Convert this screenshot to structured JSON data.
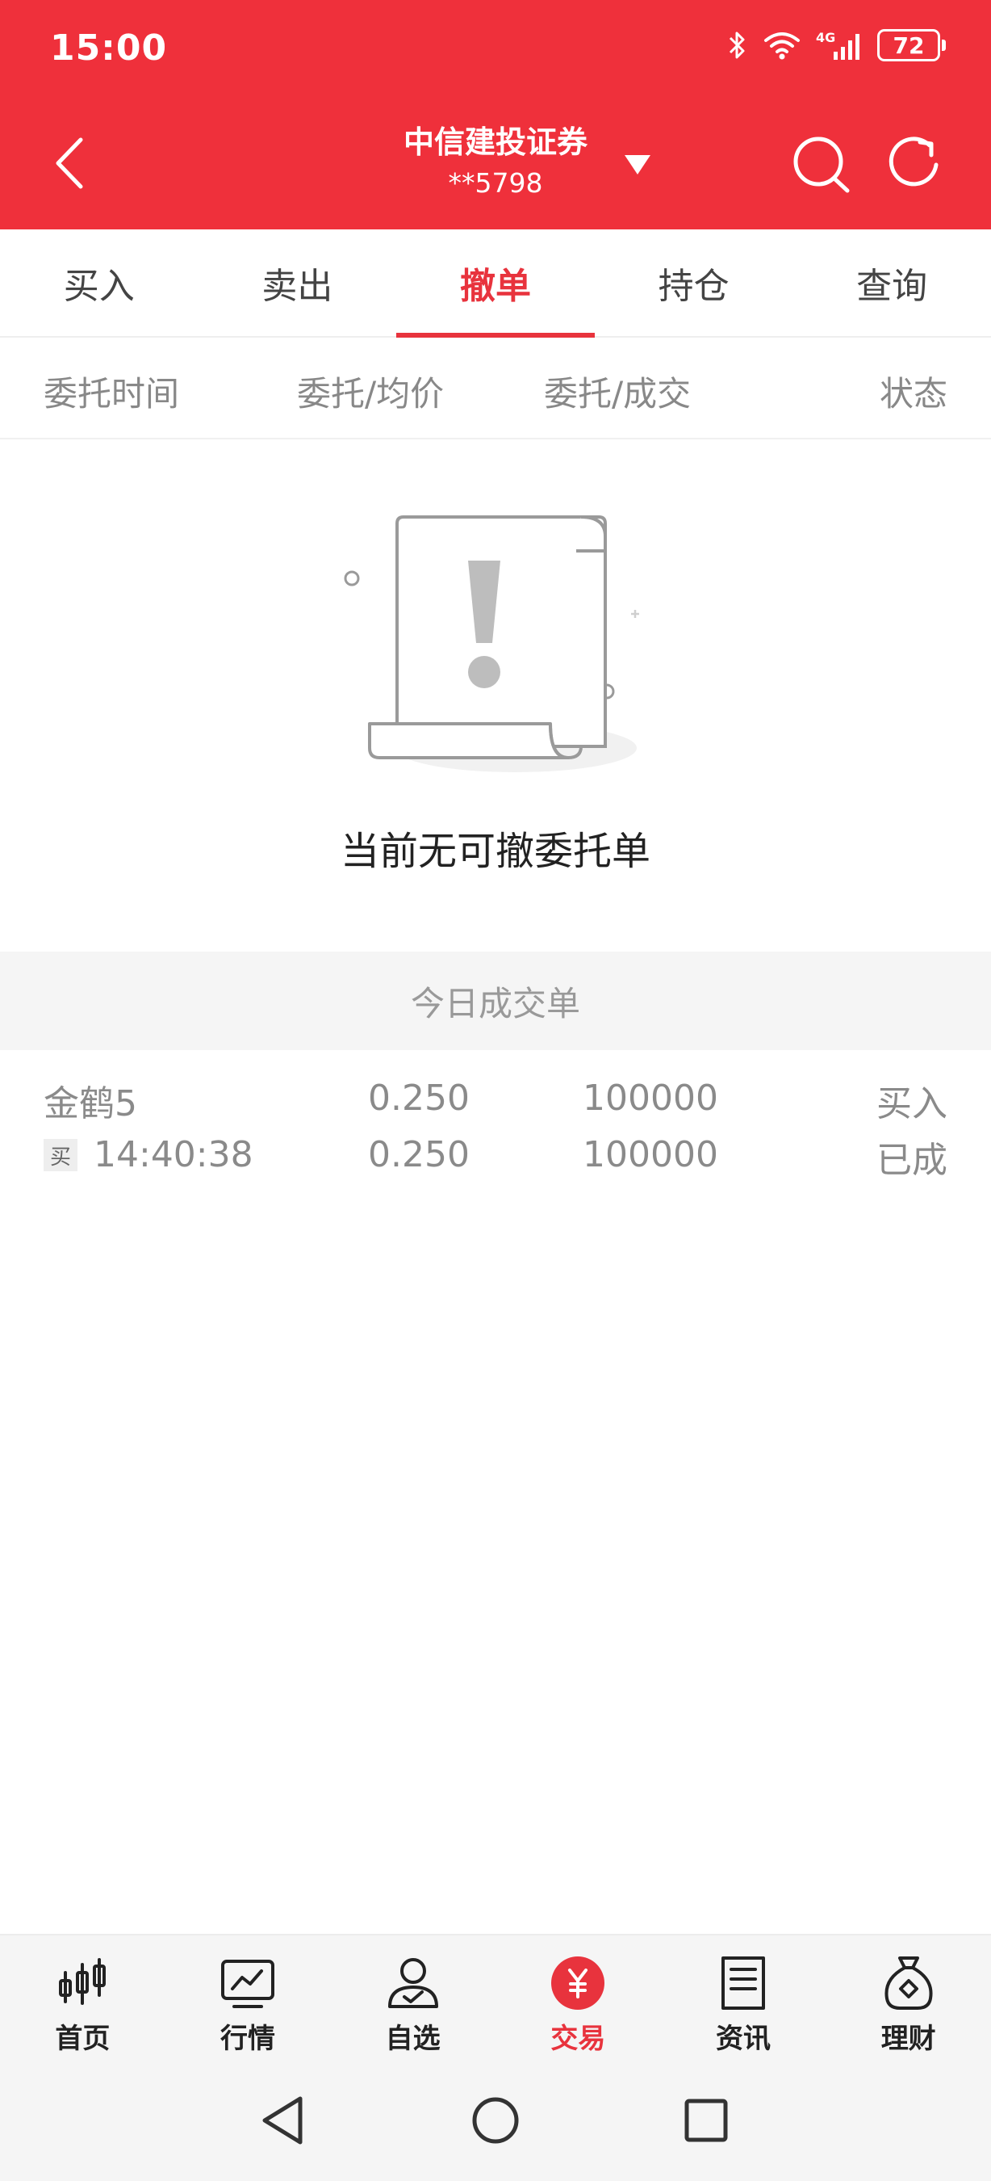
{
  "status_bar": {
    "time": "15:00",
    "network": "4G",
    "battery": "72"
  },
  "header": {
    "broker_name": "中信建投证券",
    "account": "**5798"
  },
  "main_tabs": [
    {
      "label": "买入",
      "active": false
    },
    {
      "label": "卖出",
      "active": false
    },
    {
      "label": "撤单",
      "active": true
    },
    {
      "label": "持仓",
      "active": false
    },
    {
      "label": "查询",
      "active": false
    }
  ],
  "column_headers": [
    "委托时间",
    "委托/均价",
    "委托/成交",
    "状态"
  ],
  "empty_state": {
    "message": "当前无可撤委托单"
  },
  "today_deals": {
    "section_title": "今日成交单",
    "rows": [
      {
        "name": "金鹤5",
        "side_tag": "买",
        "time": "14:40:38",
        "order_price": "0.250",
        "avg_price": "0.250",
        "order_qty": "100000",
        "deal_qty": "100000",
        "direction": "买入",
        "status": "已成"
      }
    ]
  },
  "bottom_nav": [
    {
      "label": "首页",
      "icon": "candlestick-icon",
      "active": false
    },
    {
      "label": "行情",
      "icon": "chart-icon",
      "active": false
    },
    {
      "label": "自选",
      "icon": "user-check-icon",
      "active": false
    },
    {
      "label": "交易",
      "icon": "yuan-icon",
      "active": true
    },
    {
      "label": "资讯",
      "icon": "document-icon",
      "active": false
    },
    {
      "label": "理财",
      "icon": "money-bag-icon",
      "active": false
    }
  ],
  "colors": {
    "brand_red": "#ef303b",
    "accent_red": "#e8333d"
  }
}
